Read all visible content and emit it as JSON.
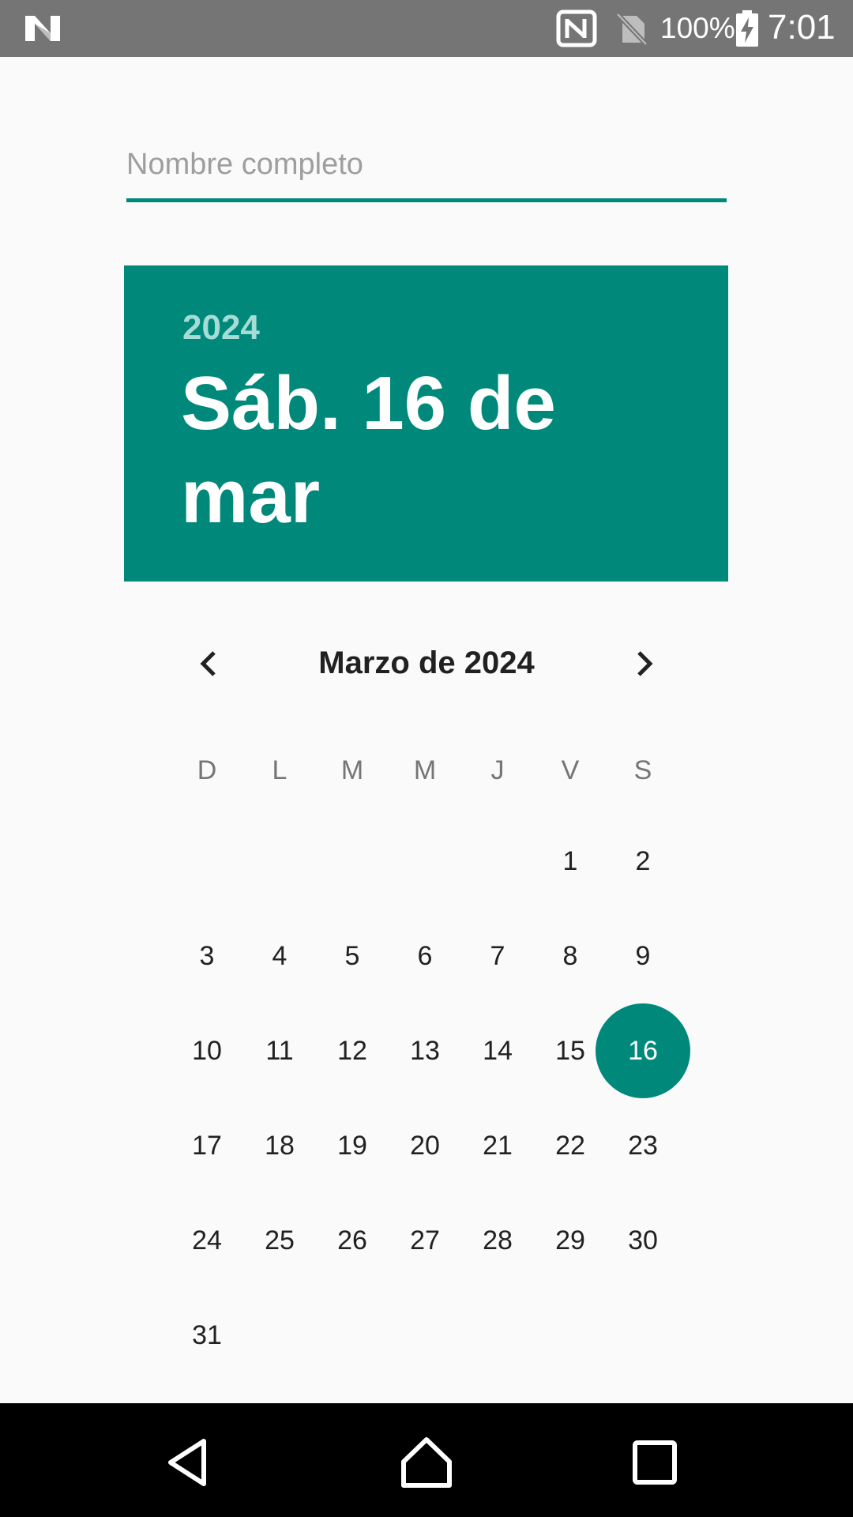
{
  "status_bar": {
    "battery_percent": "100%",
    "time": "7:01",
    "icons": [
      "n-logo-icon",
      "nfc-icon",
      "no-sim-icon",
      "battery-charging-icon"
    ]
  },
  "form": {
    "name_placeholder": "Nombre completo",
    "name_value": ""
  },
  "date_picker": {
    "header_year": "2024",
    "header_date": "Sáb. 16 de mar",
    "month_title": "Marzo de 2024",
    "weekdays": [
      "D",
      "L",
      "M",
      "M",
      "J",
      "V",
      "S"
    ],
    "weeks": [
      [
        "",
        "",
        "",
        "",
        "",
        "1",
        "2"
      ],
      [
        "3",
        "4",
        "5",
        "6",
        "7",
        "8",
        "9"
      ],
      [
        "10",
        "11",
        "12",
        "13",
        "14",
        "15",
        "16"
      ],
      [
        "17",
        "18",
        "19",
        "20",
        "21",
        "22",
        "23"
      ],
      [
        "24",
        "25",
        "26",
        "27",
        "28",
        "29",
        "30"
      ],
      [
        "31",
        "",
        "",
        "",
        "",
        "",
        ""
      ]
    ],
    "selected_day": "16",
    "accent_color": "#00897b"
  },
  "nav_bar": {
    "buttons": [
      "back-icon",
      "home-icon",
      "recents-icon"
    ]
  }
}
